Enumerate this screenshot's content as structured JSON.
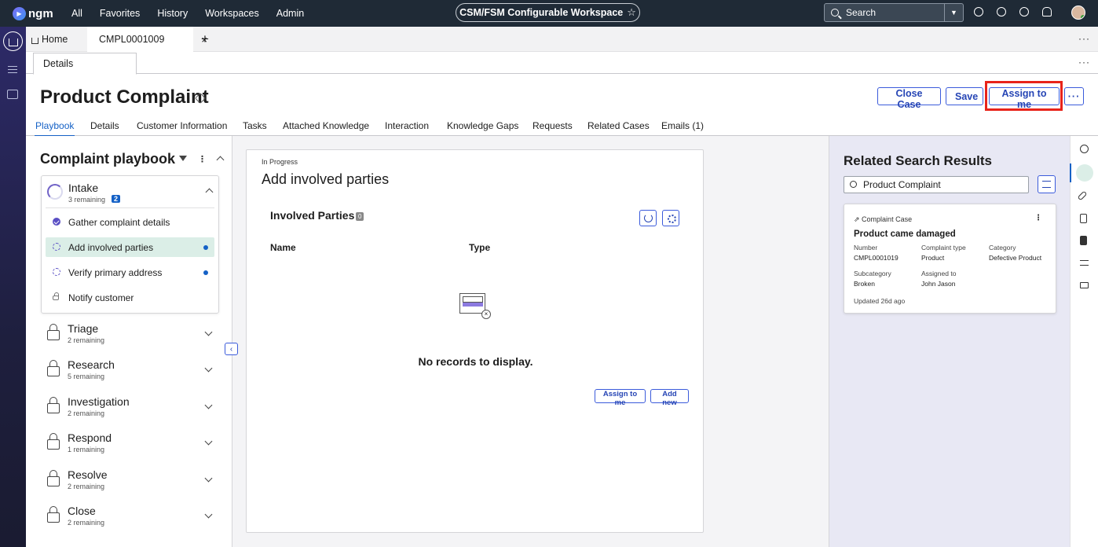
{
  "topbar": {
    "brand": "ngm",
    "nav": [
      "All",
      "Favorites",
      "History",
      "Workspaces",
      "Admin"
    ],
    "workspace": "CSM/FSM Configurable Workspace",
    "search_placeholder": "Search",
    "icons": [
      "globe-icon",
      "chat-icon",
      "help-icon",
      "bell-icon"
    ]
  },
  "tabs": {
    "home": "Home",
    "case": "CMPL0001009",
    "close": "×",
    "add": "+",
    "more": "···"
  },
  "subtab": {
    "details": "Details",
    "more": "···"
  },
  "header": {
    "title": "Product Complaint",
    "buttons": {
      "close_case": "Close Case",
      "save": "Save",
      "assign": "Assign to me",
      "more": "···"
    }
  },
  "case_tabs": [
    "Playbook",
    "Details",
    "Customer Information",
    "Tasks",
    "Attached Knowledge",
    "Interaction",
    "Knowledge Gaps",
    "Requests",
    "Related Cases",
    "Emails (1)"
  ],
  "playbook": {
    "title": "Complaint playbook",
    "active_stage": {
      "name": "Intake",
      "remaining": "3 remaining",
      "badge": "2",
      "steps": [
        {
          "label": "Gather complaint details",
          "state": "done"
        },
        {
          "label": "Add involved parties",
          "state": "in-progress",
          "active": true,
          "dot": true
        },
        {
          "label": "Verify primary address",
          "state": "in-progress",
          "dot": true
        },
        {
          "label": "Notify customer",
          "state": "locked"
        }
      ]
    },
    "stages": [
      {
        "name": "Triage",
        "remaining": "2 remaining"
      },
      {
        "name": "Research",
        "remaining": "5 remaining"
      },
      {
        "name": "Investigation",
        "remaining": "2 remaining"
      },
      {
        "name": "Respond",
        "remaining": "1 remaining"
      },
      {
        "name": "Resolve",
        "remaining": "2 remaining"
      },
      {
        "name": "Close",
        "remaining": "2 remaining"
      }
    ]
  },
  "task": {
    "status": "In Progress",
    "title": "Add involved parties",
    "list_title": "Involved Parties",
    "count": "0",
    "columns": [
      "Name",
      "Type"
    ],
    "empty": "No records to display.",
    "assign_btn": "Assign to me",
    "add_btn": "Add new"
  },
  "related": {
    "title": "Related Search Results",
    "search_value": "Product Complaint",
    "card": {
      "type": "Complaint Case",
      "title": "Product came damaged",
      "fields": [
        {
          "label": "Number",
          "value": "CMPL0001019"
        },
        {
          "label": "Complaint type",
          "value": "Product"
        },
        {
          "label": "Category",
          "value": "Defective Product"
        },
        {
          "label": "Subcategory",
          "value": "Broken"
        },
        {
          "label": "Assigned to",
          "value": "John Jason"
        }
      ],
      "updated": "Updated 26d ago"
    }
  },
  "colors": {
    "accent": "#1561c6",
    "button": "#2645b5",
    "topbar": "#1f2a36",
    "highlight": "#e8231a"
  }
}
